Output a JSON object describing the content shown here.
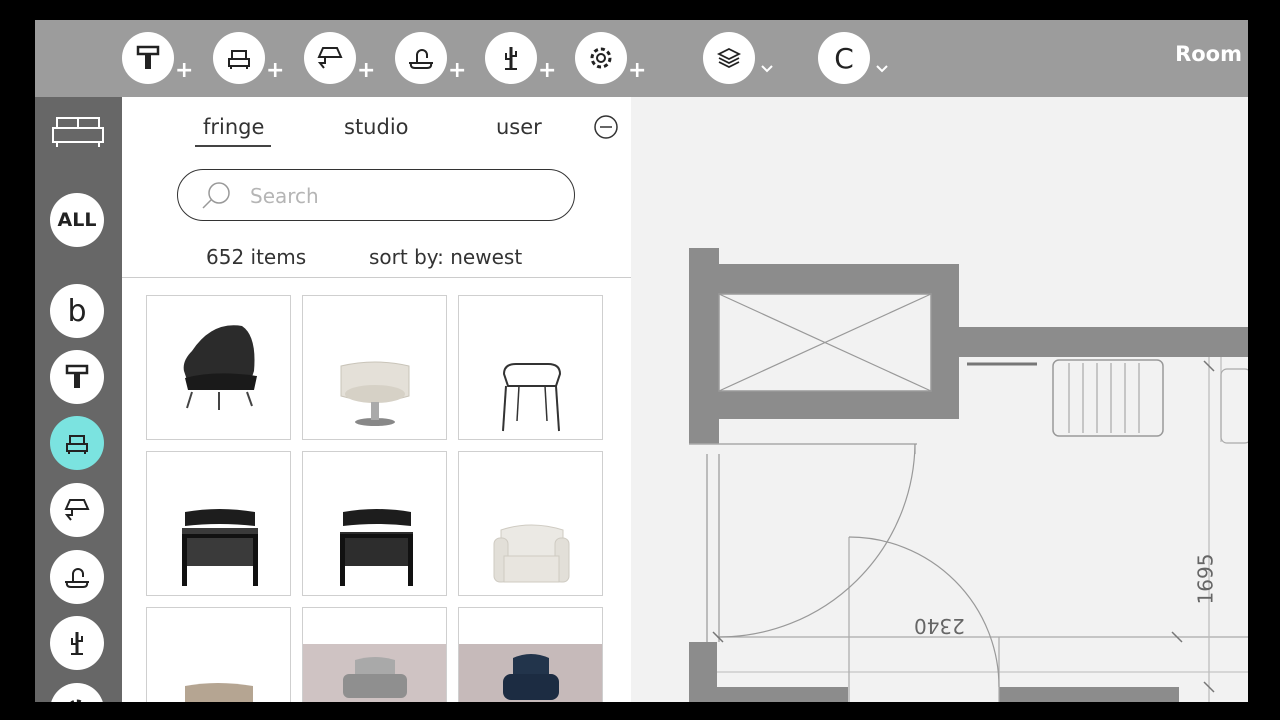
{
  "toolbar": {
    "buttons": [
      {
        "icon": "paint-roller-icon",
        "suffix": "+"
      },
      {
        "icon": "armchair-icon",
        "suffix": "+"
      },
      {
        "icon": "lamp-icon",
        "suffix": "+"
      },
      {
        "icon": "faucet-icon",
        "suffix": "+"
      },
      {
        "icon": "cactus-icon",
        "suffix": "+"
      },
      {
        "icon": "gear-icon",
        "suffix": "+"
      }
    ],
    "layers_icon": "layers-icon",
    "user_initial": "C",
    "room_label": "Room"
  },
  "sidebar": {
    "all_label": "ALL",
    "b_label": "b",
    "active_category": "armchair"
  },
  "panel": {
    "tabs": [
      "fringe",
      "studio",
      "user"
    ],
    "active_tab": "fringe",
    "search_placeholder": "Search",
    "item_count": "652 items",
    "sort_label": "sort by: newest"
  },
  "plan": {
    "dimension_vertical": "1695",
    "dimension_horizontal": "2340"
  },
  "colors": {
    "topbar": "#9c9c9c",
    "sidebar": "#676767",
    "active": "#7be3e0",
    "wall": "#8c8c8c"
  }
}
